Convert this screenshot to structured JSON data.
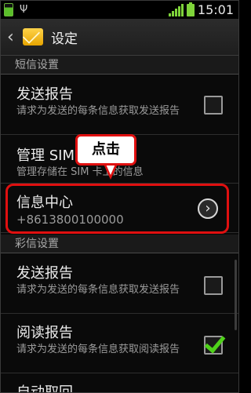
{
  "status": {
    "time": "15:01"
  },
  "action_bar": {
    "title": "设定"
  },
  "sections": [
    {
      "header": "短信设置"
    },
    {
      "header": "彩信设置"
    }
  ],
  "items": [
    {
      "title": "发送报告",
      "summary": "请求为发送的每条信息获取发送报告",
      "checked": false
    },
    {
      "title": "管理 SIM 卡信息",
      "summary": "管理存储在 SIM 卡上的信息"
    },
    {
      "title": "信息中心",
      "summary": "+8613800100000"
    },
    {
      "title": "发送报告",
      "summary": "请求为发送的每条信息获取发送报告",
      "checked": false
    },
    {
      "title": "阅读报告",
      "summary": "请求为发送的每条信息获取阅读报告",
      "checked": true
    },
    {
      "title": "自动取回"
    }
  ],
  "callout": {
    "label": "点击"
  }
}
